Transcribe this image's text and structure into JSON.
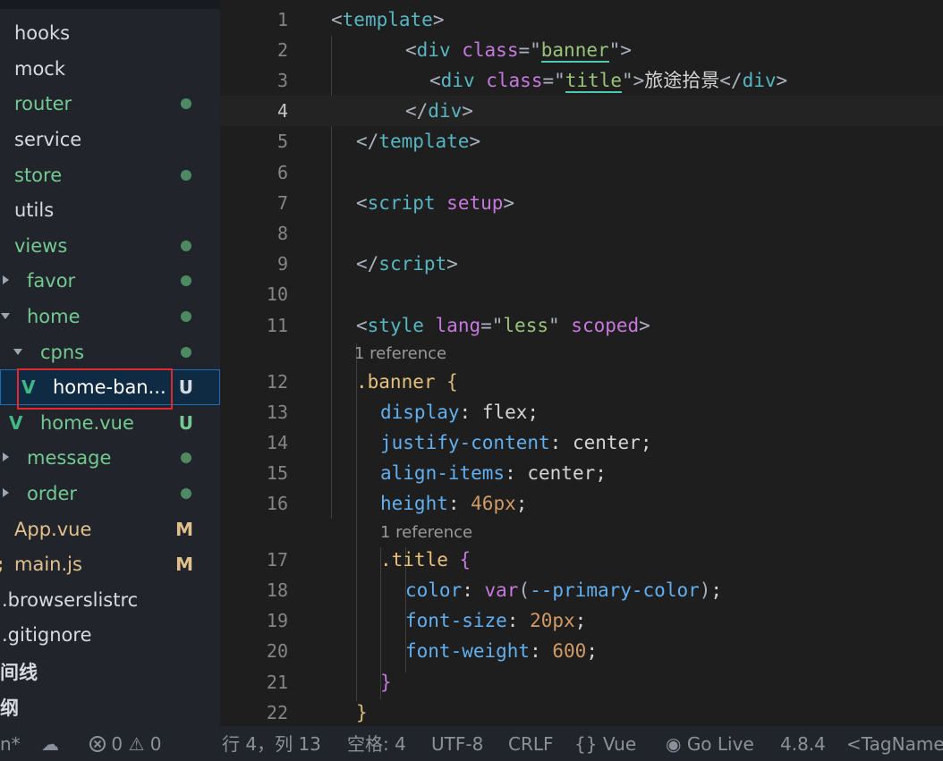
{
  "explorer": {
    "rows": [
      {
        "label": "hooks",
        "color": "grey"
      },
      {
        "label": "mock",
        "color": "grey"
      },
      {
        "label": "router",
        "color": "green",
        "dot": true
      },
      {
        "label": "service",
        "color": "grey"
      },
      {
        "label": "store",
        "color": "green",
        "dot": true
      },
      {
        "label": "utils",
        "color": "grey"
      },
      {
        "label": "views",
        "color": "green",
        "dot": true
      },
      {
        "label": "favor",
        "color": "green",
        "dot": true,
        "chevron": "right"
      },
      {
        "label": "home",
        "color": "green",
        "dot": true,
        "chevron": "down"
      },
      {
        "label": "cpns",
        "color": "green",
        "dot": true,
        "chevron": "down"
      },
      {
        "label": "home-ban...",
        "color": "white",
        "badge": "U",
        "icon": "vue-icon",
        "selected": true
      },
      {
        "label": "home.vue",
        "color": "green",
        "badge": "U",
        "icon": "vue-icon"
      },
      {
        "label": "message",
        "color": "green",
        "dot": true,
        "chevron": "right"
      },
      {
        "label": "order",
        "color": "green",
        "dot": true,
        "chevron": "right"
      },
      {
        "label": "App.vue",
        "color": "orange",
        "badge": "M"
      },
      {
        "label": "main.js",
        "color": "orange",
        "badge": "M",
        "icon": "js-icon"
      },
      {
        "label": ".browserslistrc",
        "color": "grey"
      },
      {
        "label": ".gitignore",
        "color": "grey"
      }
    ],
    "outline_label": "间线",
    "timeline_label": "纲"
  },
  "editor": {
    "line_numbers": [
      "1",
      "2",
      "3",
      "4",
      "5",
      "6",
      "7",
      "8",
      "9",
      "10",
      "11",
      "12",
      "13",
      "14",
      "15",
      "16",
      "17",
      "18",
      "19",
      "20",
      "21",
      "22"
    ],
    "active_line": "4",
    "codelens": [
      "1 reference",
      "1 reference"
    ],
    "lines": [
      [
        [
          "<",
          "punct"
        ],
        [
          "template",
          "tag"
        ],
        [
          ">",
          "punct"
        ]
      ],
      [
        [
          "<",
          "punct"
        ],
        [
          "div",
          "tag"
        ],
        [
          " ",
          "val"
        ],
        [
          "class",
          "attr"
        ],
        [
          "=\"",
          "punct"
        ],
        [
          "banner",
          "str_ul"
        ],
        [
          "\">",
          "punct"
        ]
      ],
      [
        [
          "<",
          "punct"
        ],
        [
          "div",
          "tag"
        ],
        [
          " ",
          "val"
        ],
        [
          "class",
          "attr"
        ],
        [
          "=\"",
          "punct"
        ],
        [
          "title",
          "str_ul"
        ],
        [
          "\">",
          "punct"
        ],
        [
          "旅途拾景",
          "val"
        ],
        [
          "</",
          "punct"
        ],
        [
          "div",
          "tag"
        ],
        [
          ">",
          "punct"
        ]
      ],
      [
        [
          "</",
          "punct"
        ],
        [
          "div",
          "tag"
        ],
        [
          ">",
          "punct"
        ]
      ],
      [
        [
          "</",
          "punct"
        ],
        [
          "template",
          "tag"
        ],
        [
          ">",
          "punct"
        ]
      ],
      [],
      [
        [
          "<",
          "punct"
        ],
        [
          "script",
          "tag"
        ],
        [
          " ",
          "val"
        ],
        [
          "setup",
          "attr"
        ],
        [
          ">",
          "punct"
        ]
      ],
      [],
      [
        [
          "</",
          "punct"
        ],
        [
          "script",
          "tag"
        ],
        [
          ">",
          "punct"
        ]
      ],
      [],
      [
        [
          "<",
          "punct"
        ],
        [
          "style",
          "tag"
        ],
        [
          " ",
          "val"
        ],
        [
          "lang",
          "attr"
        ],
        [
          "=\"",
          "punct"
        ],
        [
          "less",
          "str"
        ],
        [
          "\"",
          "punct"
        ],
        [
          " ",
          "val"
        ],
        [
          "scoped",
          "attr"
        ],
        [
          ">",
          "punct"
        ]
      ],
      [
        [
          ".banner",
          "cls"
        ],
        [
          " ",
          "val"
        ],
        [
          "{",
          "b1"
        ]
      ],
      [
        [
          "display",
          "prop"
        ],
        [
          ": ",
          "val"
        ],
        [
          "flex",
          "val"
        ],
        [
          ";",
          "val"
        ]
      ],
      [
        [
          "justify-content",
          "prop"
        ],
        [
          ": ",
          "val"
        ],
        [
          "center",
          "val"
        ],
        [
          ";",
          "val"
        ]
      ],
      [
        [
          "align-items",
          "prop"
        ],
        [
          ": ",
          "val"
        ],
        [
          "center",
          "val"
        ],
        [
          ";",
          "val"
        ]
      ],
      [
        [
          "height",
          "prop"
        ],
        [
          ": ",
          "val"
        ],
        [
          "46px",
          "num"
        ],
        [
          ";",
          "val"
        ]
      ],
      [
        [
          ".title",
          "cls"
        ],
        [
          " ",
          "val"
        ],
        [
          "{",
          "b2"
        ]
      ],
      [
        [
          "color",
          "prop"
        ],
        [
          ": ",
          "val"
        ],
        [
          "var",
          "attr"
        ],
        [
          "(",
          "punct"
        ],
        [
          "--primary-color",
          "prop"
        ],
        [
          ")",
          "punct"
        ],
        [
          ";",
          "val"
        ]
      ],
      [
        [
          "font-size",
          "prop"
        ],
        [
          ": ",
          "val"
        ],
        [
          "20px",
          "num"
        ],
        [
          ";",
          "val"
        ]
      ],
      [
        [
          "font-weight",
          "prop"
        ],
        [
          ": ",
          "val"
        ],
        [
          "600",
          "num"
        ],
        [
          ";",
          "val"
        ]
      ],
      [
        [
          "}",
          "b2"
        ]
      ],
      [
        [
          "}",
          "b1"
        ]
      ]
    ]
  },
  "statusbar": {
    "branch": "n*",
    "errors": "0",
    "warnings": "0",
    "position": "行 4，列 13",
    "indent": "空格: 4",
    "encoding": "UTF-8",
    "eol": "CRLF",
    "language": "Vue",
    "golive": "Go Live",
    "version": "4.8.4",
    "tagname": "<TagName"
  },
  "colors": {
    "sidebar_bg": "#21252b",
    "editor_bg": "#1e1e1e",
    "git_green": "#73c991",
    "git_modified": "#e2c08d",
    "highlight_border": "#e0282d"
  }
}
